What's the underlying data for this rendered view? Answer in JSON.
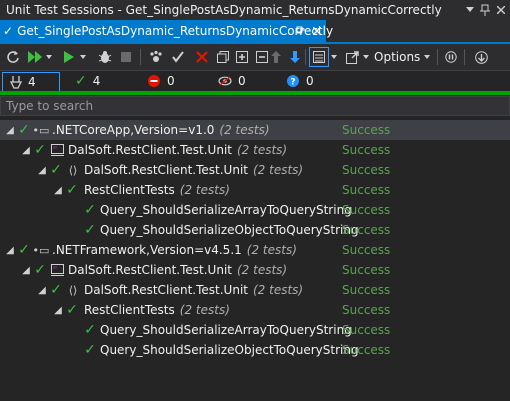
{
  "window": {
    "title": "Unit Test Sessions - Get_SinglePostAsDynamic_ReturnsDynamicCorrectly"
  },
  "tab": {
    "label": "Get_SinglePostAsDynamic_ReturnsDynamicCorrectly"
  },
  "toolbar": {
    "options_label": "Options"
  },
  "counts": {
    "total": "4",
    "passed": "4",
    "failed": "0",
    "ignored": "0",
    "unknown": "0"
  },
  "progress": {
    "passed_fraction": 1.0
  },
  "search": {
    "placeholder": "Type to search"
  },
  "tree": {
    "rows": [
      {
        "name": ".NETCoreApp,Version=v1.0",
        "meta": "(2 tests)",
        "status": "Success"
      },
      {
        "name": "DalSoft.RestClient.Test.Unit",
        "meta": "(2 tests)",
        "status": "Success"
      },
      {
        "name": "DalSoft.RestClient.Test.Unit",
        "meta": "(2 tests)",
        "status": "Success"
      },
      {
        "name": "RestClientTests",
        "meta": "(2 tests)",
        "status": "Success"
      },
      {
        "name": "Query_ShouldSerializeArrayToQueryString",
        "meta": "",
        "status": "Success"
      },
      {
        "name": "Query_ShouldSerializeObjectToQueryString",
        "meta": "",
        "status": "Success"
      },
      {
        "name": ".NETFramework,Version=v4.5.1",
        "meta": "(2 tests)",
        "status": "Success"
      },
      {
        "name": "DalSoft.RestClient.Test.Unit",
        "meta": "(2 tests)",
        "status": "Success"
      },
      {
        "name": "DalSoft.RestClient.Test.Unit",
        "meta": "(2 tests)",
        "status": "Success"
      },
      {
        "name": "RestClientTests",
        "meta": "(2 tests)",
        "status": "Success"
      },
      {
        "name": "Query_ShouldSerializeArrayToQueryString",
        "meta": "",
        "status": "Success"
      },
      {
        "name": "Query_ShouldSerializeObjectToQueryString",
        "meta": "",
        "status": "Success"
      }
    ]
  },
  "colors": {
    "accent": "#007acc",
    "success": "#57a64a",
    "check": "#3fbf3f"
  }
}
